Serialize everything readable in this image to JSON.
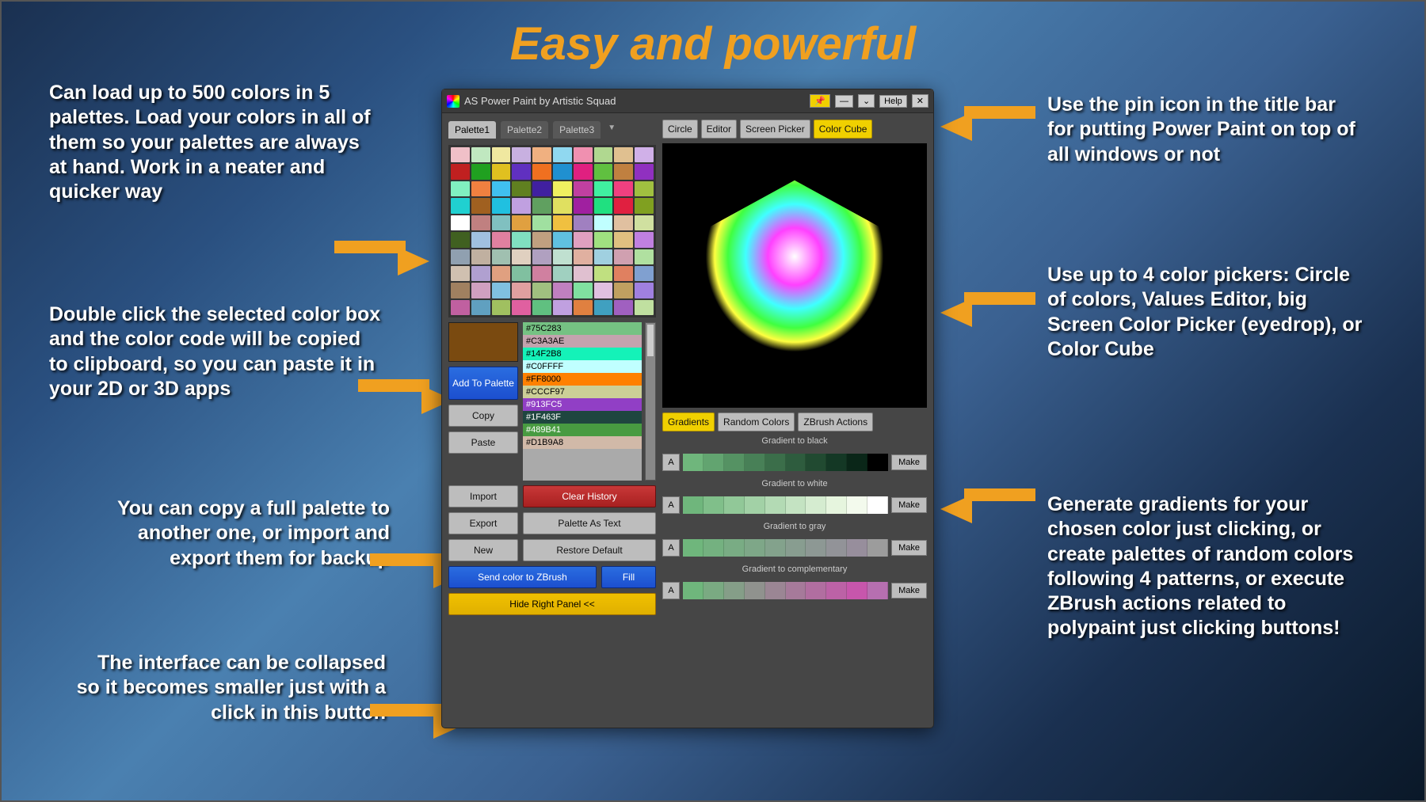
{
  "headline": "Easy and powerful",
  "callouts": {
    "c1": "Can load up to 500 colors in 5 palettes. Load your colors in all of them so your palettes are always at hand. Work in a neater and quicker way",
    "c2": "Double click the selected color box and the color code will be copied to clipboard, so you can paste it in your 2D or 3D apps",
    "c3": "You can copy a full palette to another one, or import and export them for backup",
    "c4": "The interface can be collapsed so it becomes smaller just with a click in this button",
    "c5": "Use the pin icon in the title bar for putting Power Paint on top of all windows or not",
    "c6": "Use up to 4 color pickers: Circle of colors, Values Editor, big Screen Color Picker (eyedrop), or Color Cube",
    "c7": "Generate gradients for your chosen color just clicking, or create palettes of random colors following 4 patterns, or execute ZBrush actions related to polypaint just clicking buttons!"
  },
  "app": {
    "title": "AS Power Paint by Artistic Squad",
    "help": "Help",
    "palette_tabs": [
      "Palette1",
      "Palette2",
      "Palette3"
    ],
    "picker_tabs": [
      "Circle",
      "Editor",
      "Screen Picker",
      "Color Cube"
    ],
    "active_picker": 3,
    "action_tabs": [
      "Gradients",
      "Random Colors",
      "ZBrush Actions"
    ],
    "buttons": {
      "add": "Add To Palette",
      "copy": "Copy",
      "paste": "Paste",
      "import": "Import",
      "export": "Export",
      "new": "New",
      "clear_history": "Clear History",
      "palette_as_text": "Palette As Text",
      "restore_default": "Restore Default",
      "send_zbrush": "Send color to ZBrush",
      "fill": "Fill",
      "hide_panel": "Hide Right Panel <<",
      "make": "Make",
      "a": "A"
    },
    "history": [
      {
        "hex": "#75C283",
        "bg": "#75C283"
      },
      {
        "hex": "#C3A3AE",
        "bg": "#C3A3AE"
      },
      {
        "hex": "#14F2B8",
        "bg": "#14F2B8"
      },
      {
        "hex": "#C0FFFF",
        "bg": "#C0FFFF"
      },
      {
        "hex": "#FF8000",
        "bg": "#FF8000"
      },
      {
        "hex": "#CCCF97",
        "bg": "#CCCF97"
      },
      {
        "hex": "#913FC5",
        "bg": "#913FC5"
      },
      {
        "hex": "#1F463F",
        "bg": "#1F463F"
      },
      {
        "hex": "#489B41",
        "bg": "#489B41"
      },
      {
        "hex": "#D1B9A8",
        "bg": "#D1B9A8"
      }
    ],
    "gradients": [
      {
        "label": "Gradient to black",
        "colors": [
          "#6fb67c",
          "#62a470",
          "#559263",
          "#488057",
          "#3b6e4a",
          "#2e5c3e",
          "#214a31",
          "#143825",
          "#0a2618",
          "#000000"
        ]
      },
      {
        "label": "Gradient to white",
        "colors": [
          "#6fb67c",
          "#80bf8a",
          "#91c898",
          "#a2d1a6",
          "#b3dab4",
          "#c4e3c2",
          "#d5ecd0",
          "#e6f5de",
          "#f3faed",
          "#ffffff"
        ]
      },
      {
        "label": "Gradient to gray",
        "colors": [
          "#6fb67c",
          "#74b180",
          "#79ac84",
          "#7ea788",
          "#83a28c",
          "#889d90",
          "#8d9894",
          "#929398",
          "#978e9c",
          "#9c9c9c"
        ]
      },
      {
        "label": "Gradient to complementary",
        "colors": [
          "#6fb67c",
          "#7aaa82",
          "#859e88",
          "#90928e",
          "#9b8694",
          "#a67a9a",
          "#b16ea0",
          "#bc62a6",
          "#c756ac",
          "#b66fb0"
        ]
      }
    ],
    "selected_color": "#7a4a10",
    "palette_colors": [
      "#f0c0c8",
      "#c0e8c0",
      "#f0e8a0",
      "#c8b0e0",
      "#f0b080",
      "#90d8f0",
      "#f090b0",
      "#b0d890",
      "#e0c090",
      "#d0b0e8",
      "#c02020",
      "#20a020",
      "#e0c020",
      "#6030c0",
      "#f07020",
      "#2090d0",
      "#e02080",
      "#60c040",
      "#c08040",
      "#9030c0",
      "#80f0c0",
      "#f08040",
      "#40c0f0",
      "#608020",
      "#4020a0",
      "#f0f060",
      "#c040a0",
      "#40f0a0",
      "#f04080",
      "#a0c040",
      "#20d0d0",
      "#a06020",
      "#20c0e0",
      "#c0a0e0",
      "#60a060",
      "#e0e060",
      "#a020a0",
      "#20e080",
      "#e02040",
      "#80a020",
      "#ffffff",
      "#c08080",
      "#80c0c0",
      "#e0a040",
      "#a0e0a0",
      "#f0c040",
      "#a080c0",
      "#c0ffff",
      "#e0c0a0",
      "#d0e0a0",
      "#406020",
      "#a0c0e0",
      "#e080a0",
      "#80e0c0",
      "#c0a080",
      "#60c0e0",
      "#e0a0c0",
      "#a0e080",
      "#e0c080",
      "#c080e0",
      "#90a0b0",
      "#c0b0a0",
      "#a0c0b0",
      "#e0d0c0",
      "#b0a0c0",
      "#c0e0d0",
      "#e0b0a0",
      "#a0d0e0",
      "#d0a0b0",
      "#b0e0a0",
      "#d0c0b0",
      "#b0a0d0",
      "#e0a080",
      "#80c0a0",
      "#d080a0",
      "#a0d0c0",
      "#e0c0d0",
      "#c0e080",
      "#e08060",
      "#80a0d0",
      "#a08060",
      "#d0a0c0",
      "#80c0e0",
      "#e0a0a0",
      "#a0c080",
      "#c080c0",
      "#80e0a0",
      "#e0c0e0",
      "#c0a060",
      "#a080e0",
      "#c060a0",
      "#60a0c0",
      "#a0c060",
      "#e060a0",
      "#60c080",
      "#c0a0e0",
      "#e08040",
      "#40a0c0",
      "#a060c0",
      "#c0e0a0"
    ]
  }
}
